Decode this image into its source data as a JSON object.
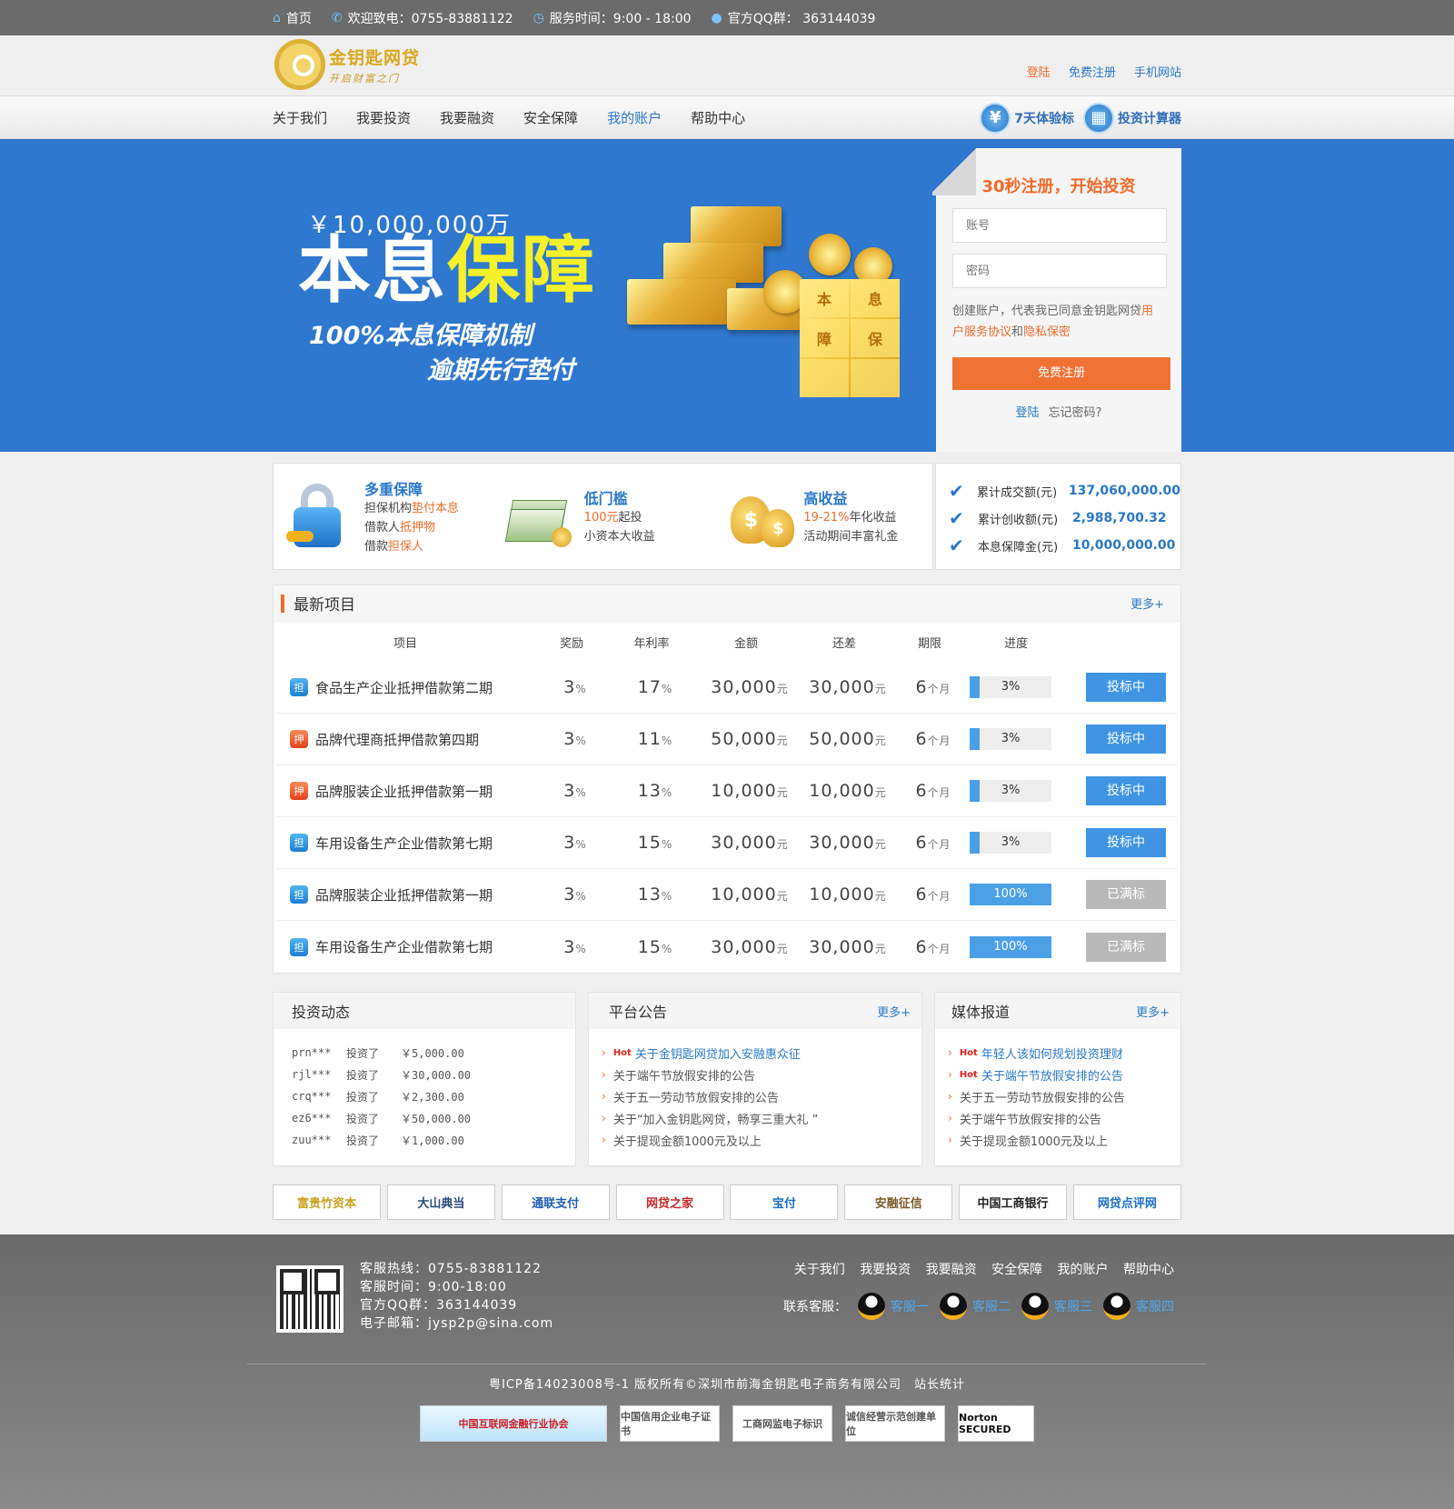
{
  "topbar": {
    "home": "首页",
    "phone": "欢迎致电：0755-83881122",
    "hours": "服务时间：9:00 - 18:00",
    "qq": "官方QQ群： 363144039"
  },
  "logo": {
    "name": "金钥匙网贷",
    "slogan": "开启财富之门"
  },
  "header_links": {
    "login": "登陆",
    "register": "免费注册",
    "mobile": "手机网站"
  },
  "nav": {
    "items": [
      "关于我们",
      "我要投资",
      "我要融资",
      "安全保障",
      "我的账户",
      "帮助中心"
    ],
    "active": "我的账户",
    "tool1": "7天体验标",
    "tool2": "投资计算器",
    "tool1_icon": "¥",
    "tool2_icon": "▦"
  },
  "banner": {
    "amount": "￥10,000,000万",
    "main1": "本息",
    "main2": "保障",
    "sub1": "100%本息保障机制",
    "sub2": "逾期先行垫付",
    "cube": [
      "本",
      "息",
      "障",
      "保",
      "",
      ""
    ]
  },
  "register": {
    "title": "30秒注册，开始投资",
    "account_placeholder": "账号",
    "password_placeholder": "密码",
    "agree_prefix": "创建账户，代表我已同意金钥匙网贷",
    "agree_link1": "用户服务协议",
    "agree_and": "和",
    "agree_link2": "隐私保密",
    "button": "免费注册",
    "login": "登陆",
    "forgot": "忘记密码?"
  },
  "features": [
    {
      "title": "多重保障",
      "l1a": "担保机构",
      "l1b": "垫付本息",
      "l2a": "借款人",
      "l2b": "抵押物",
      "l3a": "借款",
      "l3b": "担保人"
    },
    {
      "title": "低门槛",
      "l1a": "",
      "l1b": "100元",
      "l1c": "起投",
      "l2a": "小资本大收益"
    },
    {
      "title": "高收益",
      "l1b": "19-21%",
      "l1c": "年化收益",
      "l2a": "活动期间丰富礼金"
    }
  ],
  "stats": [
    {
      "label": "累计成交额(元)",
      "value": "137,060,000.00"
    },
    {
      "label": "累计创收额(元)",
      "value": "2,988,700.32"
    },
    {
      "label": "本息保障金(元)",
      "value": "10,000,000.00"
    }
  ],
  "projects": {
    "title": "最新项目",
    "more": "更多+",
    "headers": [
      "项目",
      "奖励",
      "年利率",
      "金额",
      "还差",
      "期限",
      "进度"
    ],
    "rows": [
      {
        "tag": "担",
        "tagc": "b",
        "name": "食品生产企业抵押借款第二期",
        "reward": "3",
        "rate": "17",
        "amount": "30,000",
        "remain": "30,000",
        "term": "6",
        "progress": "3%",
        "fill": 0.12,
        "status": "投标中",
        "st": "on"
      },
      {
        "tag": "押",
        "tagc": "r",
        "name": "品牌代理商抵押借款第四期",
        "reward": "3",
        "rate": "11",
        "amount": "50,000",
        "remain": "50,000",
        "term": "6",
        "progress": "3%",
        "fill": 0.12,
        "status": "投标中",
        "st": "on"
      },
      {
        "tag": "押",
        "tagc": "r",
        "name": "品牌服装企业抵押借款第一期",
        "reward": "3",
        "rate": "13",
        "amount": "10,000",
        "remain": "10,000",
        "term": "6",
        "progress": "3%",
        "fill": 0.12,
        "status": "投标中",
        "st": "on"
      },
      {
        "tag": "担",
        "tagc": "b",
        "name": "车用设备生产企业借款第七期",
        "reward": "3",
        "rate": "15",
        "amount": "30,000",
        "remain": "30,000",
        "term": "6",
        "progress": "3%",
        "fill": 0.12,
        "status": "投标中",
        "st": "on"
      },
      {
        "tag": "担",
        "tagc": "b",
        "name": "品牌服装企业抵押借款第一期",
        "reward": "3",
        "rate": "13",
        "amount": "10,000",
        "remain": "10,000",
        "term": "6",
        "progress": "100%",
        "fill": 1,
        "status": "已满标",
        "st": "off"
      },
      {
        "tag": "担",
        "tagc": "b",
        "name": "车用设备生产企业借款第七期",
        "reward": "3",
        "rate": "15",
        "amount": "30,000",
        "remain": "30,000",
        "term": "6",
        "progress": "100%",
        "fill": 1,
        "status": "已满标",
        "st": "off"
      }
    ],
    "unit_pct": "%",
    "unit_yuan": "元",
    "unit_month": "个月"
  },
  "invest": {
    "title": "投资动态",
    "rows": [
      {
        "user": "prn***",
        "act": "投资了",
        "amt": "￥5,000.00"
      },
      {
        "user": "rjl***",
        "act": "投资了",
        "amt": "￥30,000.00"
      },
      {
        "user": "crq***",
        "act": "投资了",
        "amt": "￥2,300.00"
      },
      {
        "user": "ez6***",
        "act": "投资了",
        "amt": "￥50,000.00"
      },
      {
        "user": "zuu***",
        "act": "投资了",
        "amt": "￥1,000.00"
      }
    ]
  },
  "notice": {
    "title": "平台公告",
    "more": "更多+",
    "items": [
      {
        "hot": "Hot",
        "text": "关于金钥匙网贷加入安融惠众征",
        "blue": true
      },
      {
        "hot": "",
        "text": "关于端午节放假安排的公告"
      },
      {
        "hot": "",
        "text": "关于五一劳动节放假安排的公告"
      },
      {
        "hot": "",
        "text": "关于“加入金钥匙网贷，畅享三重大礼 ”"
      },
      {
        "hot": "",
        "text": "关于提现金额1000元及以上"
      }
    ]
  },
  "media": {
    "title": "媒体报道",
    "more": "更多+",
    "items": [
      {
        "hot": "Hot",
        "text": "年轻人该如何规划投资理财",
        "blue": true
      },
      {
        "hot": "Hot",
        "text": "关于端午节放假安排的公告",
        "blue": true
      },
      {
        "hot": "",
        "text": "关于五一劳动节放假安排的公告"
      },
      {
        "hot": "",
        "text": "关于端午节放假安排的公告"
      },
      {
        "hot": "",
        "text": "关于提现金额1000元及以上"
      }
    ]
  },
  "partners": [
    {
      "name": "富贵竹资本",
      "color": "#c9a21e"
    },
    {
      "name": "大山典当",
      "color": "#2b4c7e"
    },
    {
      "name": "通联支付",
      "color": "#1e5eb8"
    },
    {
      "name": "网贷之家",
      "color": "#c22a2a"
    },
    {
      "name": "宝付",
      "color": "#1a6fc0"
    },
    {
      "name": "安融征信",
      "color": "#7a5a2a"
    },
    {
      "name": "中国工商银行",
      "color": "#222222"
    },
    {
      "name": "网贷点评网",
      "color": "#1e6fc8"
    }
  ],
  "footer": {
    "hotline": "客服热线：0755-83881122",
    "hours": "客服时间：9:00-18:00",
    "qq": "官方QQ群：363144039",
    "email": "电子邮箱：jysp2p@sina.com",
    "links": [
      "关于我们",
      "我要投资",
      "我要融资",
      "安全保障",
      "我的账户",
      "帮助中心"
    ],
    "kf_label": "联系客服：",
    "kf": [
      "客服一",
      "客服二",
      "客服三",
      "客服四"
    ],
    "copyright": "粤ICP备14023008号-1 版权所有©深圳市前海金钥匙电子商务有限公司　站长统计",
    "badges": [
      "中国互联网金融行业协会",
      "中国信用企业电子证书",
      "工商网监电子标识",
      "诚信经营示范创建单位",
      "Norton SECURED"
    ]
  }
}
